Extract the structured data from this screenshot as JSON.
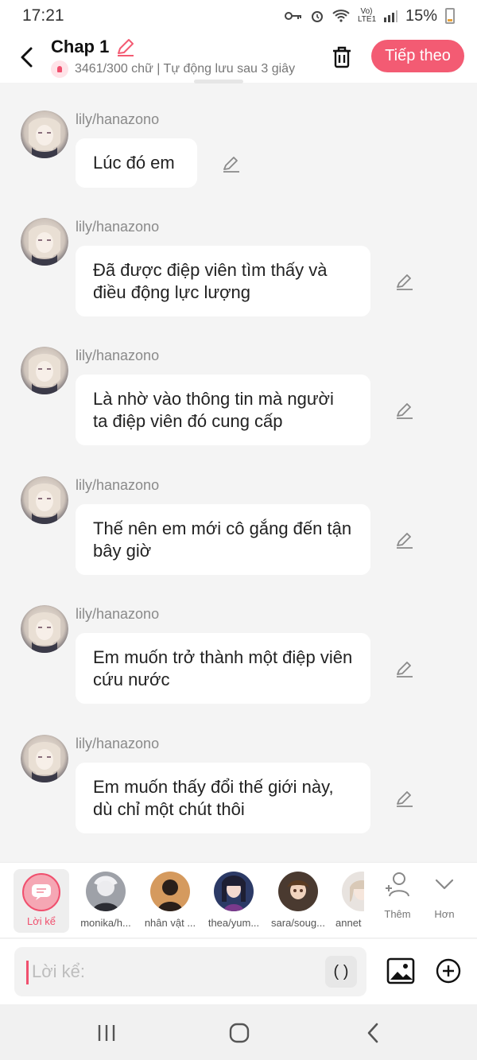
{
  "status_bar": {
    "time": "17:21",
    "network_label": "Vo) LTE1",
    "battery": "15%"
  },
  "header": {
    "title": "Chap 1",
    "subtitle": "3461/300 chữ | Tự động lưu sau 3 giây",
    "next_button": "Tiếp theo"
  },
  "messages": [
    {
      "sender": "lily/hanazono",
      "text": "Lúc đó em"
    },
    {
      "sender": "lily/hanazono",
      "text": "Đã được điệp viên tìm thấy và điều động lực lượng"
    },
    {
      "sender": "lily/hanazono",
      "text": "Là nhờ vào thông tin mà người ta điệp viên đó cung cấp"
    },
    {
      "sender": "lily/hanazono",
      "text": "Thế nên em mới cô gắng đến tận bây giờ"
    },
    {
      "sender": "lily/hanazono",
      "text": "Em muốn trở thành một điệp viên cứu nước"
    },
    {
      "sender": "lily/hanazono",
      "text": "Em muốn thấy đổi thế giới này, dù chỉ một chút thôi"
    }
  ],
  "characters": [
    {
      "name": "Lời kể"
    },
    {
      "name": "monika/h..."
    },
    {
      "name": "nhân vật ..."
    },
    {
      "name": "thea/yum..."
    },
    {
      "name": "sara/soug..."
    },
    {
      "name": "annet"
    }
  ],
  "tools": {
    "add_label": "Thêm",
    "more_label": "Hơn"
  },
  "input": {
    "placeholder": "Lời kể:",
    "paren_label": "( )"
  },
  "icons": {
    "back": "chevron-left-icon",
    "edit": "pencil-icon",
    "trash": "trash-icon",
    "image": "image-icon",
    "plus": "plus-circle-icon"
  },
  "colors": {
    "accent": "#f35b73",
    "background": "#f4f4f4"
  }
}
